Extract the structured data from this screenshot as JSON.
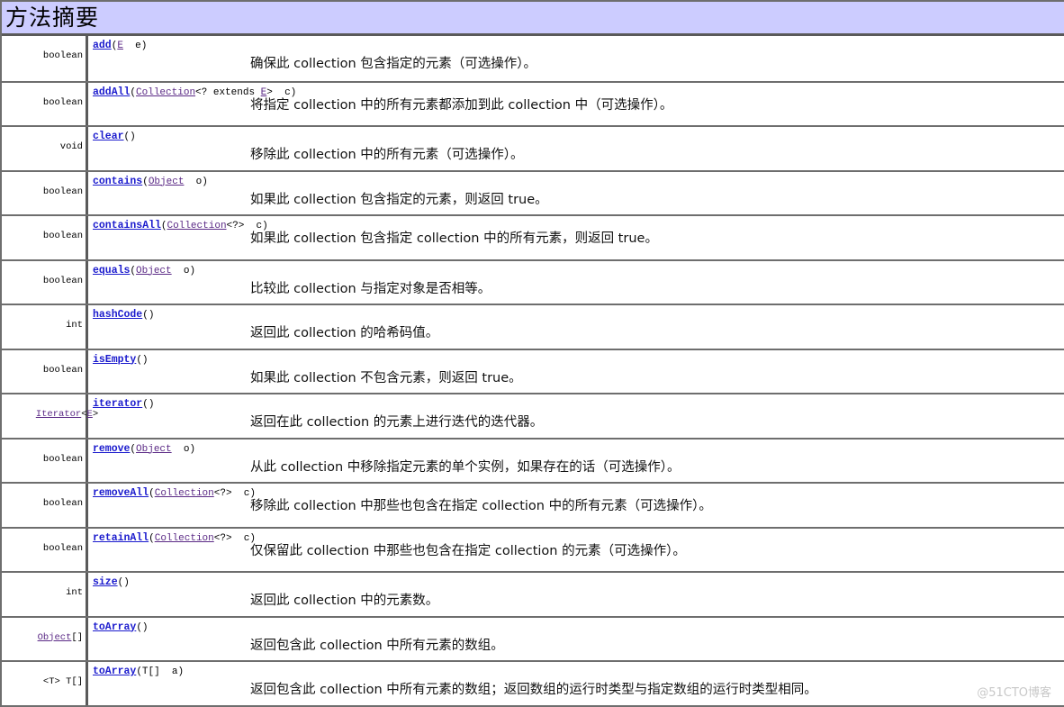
{
  "header": {
    "title": "方法摘要"
  },
  "methods": [
    {
      "return_type": "boolean",
      "return_link": "",
      "return_suffix": "",
      "name": "add",
      "params_before": "(",
      "param_type": "E",
      "params_after": "  e)",
      "description": "确保此 collection 包含指定的元素（可选操作）。"
    },
    {
      "return_type": "boolean",
      "return_link": "",
      "return_suffix": "",
      "name": "addAll",
      "params_before": "(",
      "param_type": "Collection",
      "params_after": "<? extends ",
      "param_type2": "E",
      "params_after2": ">  c)",
      "description": "将指定 collection 中的所有元素都添加到此 collection 中（可选操作）。"
    },
    {
      "return_type": "void",
      "return_link": "",
      "return_suffix": "",
      "name": "clear",
      "params_before": "()",
      "param_type": "",
      "params_after": "",
      "description": "移除此 collection 中的所有元素（可选操作）。"
    },
    {
      "return_type": "boolean",
      "return_link": "",
      "return_suffix": "",
      "name": "contains",
      "params_before": "(",
      "param_type": "Object",
      "params_after": "  o)",
      "description": "如果此 collection 包含指定的元素，则返回 true。"
    },
    {
      "return_type": "boolean",
      "return_link": "",
      "return_suffix": "",
      "name": "containsAll",
      "params_before": "(",
      "param_type": "Collection",
      "params_after": "<?>  c)",
      "description": "如果此 collection 包含指定 collection 中的所有元素，则返回 true。"
    },
    {
      "return_type": "boolean",
      "return_link": "",
      "return_suffix": "",
      "name": "equals",
      "params_before": "(",
      "param_type": "Object",
      "params_after": "  o)",
      "description": "比较此 collection 与指定对象是否相等。"
    },
    {
      "return_type": "int",
      "return_link": "",
      "return_suffix": "",
      "name": "hashCode",
      "params_before": "()",
      "param_type": "",
      "params_after": "",
      "description": "返回此 collection 的哈希码值。"
    },
    {
      "return_type": "boolean",
      "return_link": "",
      "return_suffix": "",
      "name": "isEmpty",
      "params_before": "()",
      "param_type": "",
      "params_after": "",
      "description": "如果此 collection 不包含元素，则返回 true。"
    },
    {
      "return_type": "",
      "return_link": "Iterator",
      "return_mid": "<",
      "return_link2": "E",
      "return_suffix": ">",
      "name": "iterator",
      "params_before": "()",
      "param_type": "",
      "params_after": "",
      "description": "返回在此 collection 的元素上进行迭代的迭代器。"
    },
    {
      "return_type": "boolean",
      "return_link": "",
      "return_suffix": "",
      "name": "remove",
      "params_before": "(",
      "param_type": "Object",
      "params_after": "  o)",
      "description": "从此 collection 中移除指定元素的单个实例，如果存在的话（可选操作）。"
    },
    {
      "return_type": "boolean",
      "return_link": "",
      "return_suffix": "",
      "name": "removeAll",
      "params_before": "(",
      "param_type": "Collection",
      "params_after": "<?>  c)",
      "description": "移除此 collection 中那些也包含在指定 collection 中的所有元素（可选操作）。"
    },
    {
      "return_type": "boolean",
      "return_link": "",
      "return_suffix": "",
      "name": "retainAll",
      "params_before": "(",
      "param_type": "Collection",
      "params_after": "<?>  c)",
      "description": "仅保留此 collection 中那些也包含在指定 collection 的元素（可选操作）。"
    },
    {
      "return_type": "int",
      "return_link": "",
      "return_suffix": "",
      "name": "size",
      "params_before": "()",
      "param_type": "",
      "params_after": "",
      "description": "返回此 collection 中的元素数。"
    },
    {
      "return_type": "",
      "return_link": "Object",
      "return_suffix": "[]",
      "name": "toArray",
      "params_before": "()",
      "param_type": "",
      "params_after": "",
      "description": "返回包含此 collection 中所有元素的数组。"
    },
    {
      "return_type": "<T> T[]",
      "return_link": "",
      "return_suffix": "",
      "name": "toArray",
      "params_before": "(T[]  a)",
      "param_type": "",
      "params_after": "",
      "description": "返回包含此 collection 中所有元素的数组；返回数组的运行时类型与指定数组的运行时类型相同。"
    }
  ],
  "watermark": "@51CTO博客"
}
